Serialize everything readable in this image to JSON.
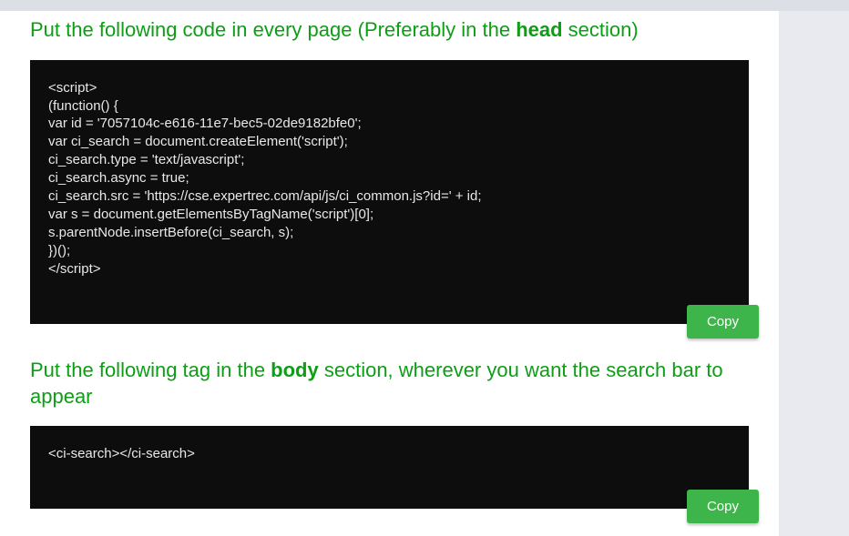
{
  "section1": {
    "heading_pre": "Put the following code in every page (Preferably in the ",
    "heading_bold": "head",
    "heading_post": " section)",
    "code": "<script>\n(function() {\nvar id = '7057104c-e616-11e7-bec5-02de9182bfe0';\nvar ci_search = document.createElement('script');\nci_search.type = 'text/javascript';\nci_search.async = true;\nci_search.src = 'https://cse.expertrec.com/api/js/ci_common.js?id=' + id;\nvar s = document.getElementsByTagName('script')[0];\ns.parentNode.insertBefore(ci_search, s);\n})();\n</script>",
    "copy_label": "Copy"
  },
  "section2": {
    "heading_pre": "Put the following tag in the ",
    "heading_bold": "body",
    "heading_post": " section, wherever you want the search bar to appear",
    "code": "<ci-search></ci-search>",
    "copy_label": "Copy"
  }
}
